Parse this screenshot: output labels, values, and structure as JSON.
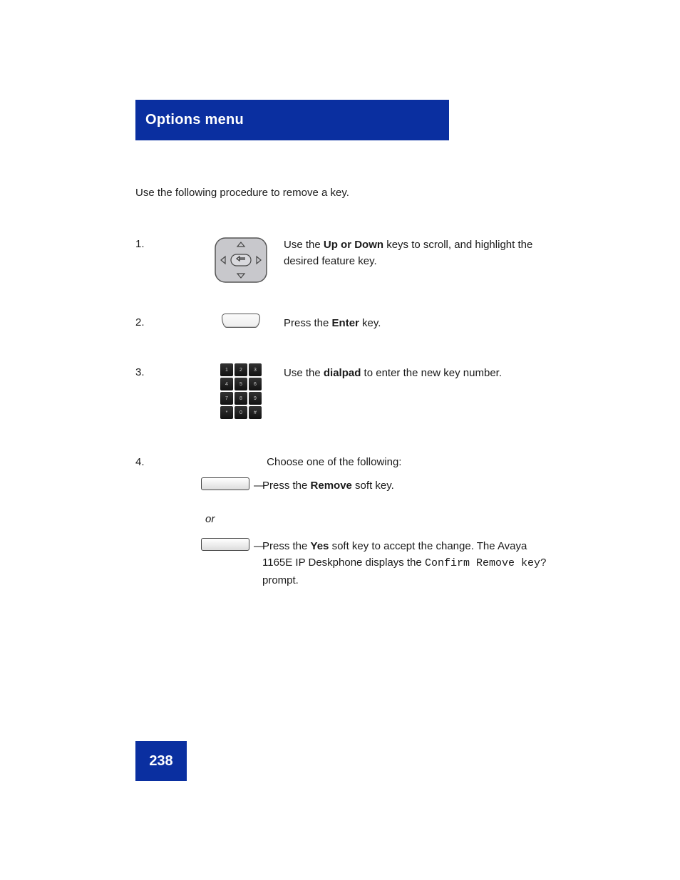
{
  "titlebar": "Options menu",
  "intro": "Use the following procedure to remove a key.",
  "steps": {
    "1": {
      "num": "1.",
      "text_a": "Use the ",
      "bold_a": "Up or Down",
      "text_b": " keys to scroll, and highlight the desired feature key."
    },
    "2": {
      "num": "2.",
      "text_a": "Press the ",
      "bold_a": "Enter",
      "text_b": " key."
    },
    "3": {
      "num": "3.",
      "text_a": "Use the ",
      "bold_a": "dialpad",
      "text_b": " to enter the new key number."
    },
    "4": {
      "num": "4.",
      "text_a": "Choose one of the following:"
    },
    "4a": {
      "dash": "—",
      "text_a": "Press the ",
      "bold_a": "Remove",
      "text_b": " soft key."
    },
    "4b": {
      "or": "or",
      "dash": "—",
      "text_a": "Press the ",
      "bold_a": "Yes",
      "text_b": " soft key to accept the change. The Avaya 1165E IP Deskphone displays the ",
      "mono_a": "Confirm Remove key?",
      "text_c": " prompt."
    }
  },
  "page_number": "238",
  "icons": {
    "dialpad_keys": [
      "1",
      "2",
      "3",
      "4",
      "5",
      "6",
      "7",
      "8",
      "9",
      "*",
      "0",
      "#"
    ]
  }
}
